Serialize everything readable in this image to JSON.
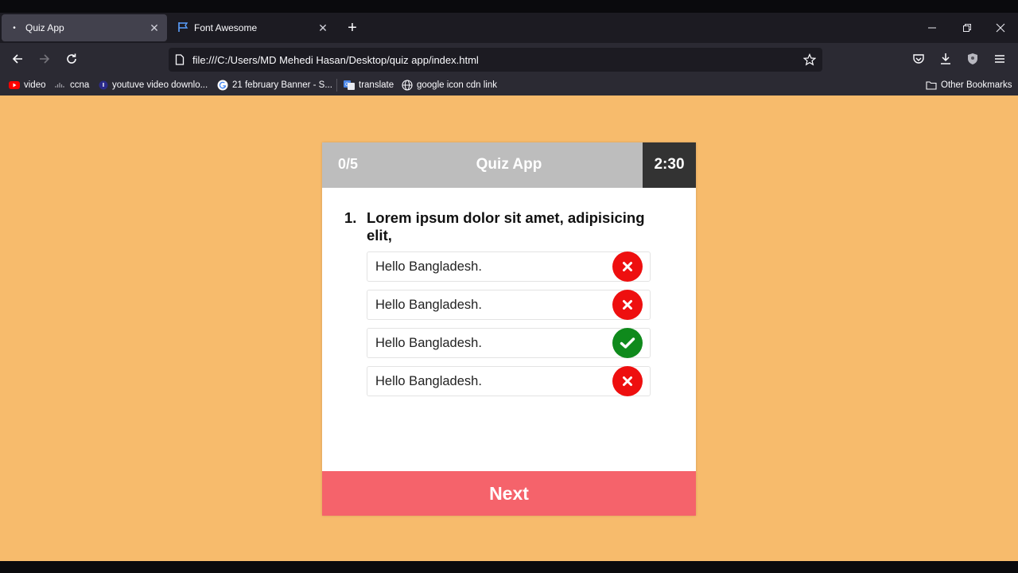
{
  "browser": {
    "tabs": [
      {
        "title": "Quiz App",
        "active": true
      },
      {
        "title": "Font Awesome",
        "active": false
      }
    ],
    "url": "file:///C:/Users/MD Mehedi Hasan/Desktop/quiz app/index.html",
    "bookmarks": [
      {
        "label": "video",
        "icon": "youtube-icon"
      },
      {
        "label": "ccna",
        "icon": "cisco-icon"
      },
      {
        "label": "youtuve video downlo...",
        "icon": "download-site-icon"
      },
      {
        "label": "21 february Banner - S...",
        "icon": "google-icon"
      },
      {
        "label": "translate",
        "icon": "translate-icon"
      },
      {
        "label": "google icon cdn link",
        "icon": "globe-icon"
      }
    ],
    "other_bookmarks": "Other Bookmarks"
  },
  "quiz": {
    "score": "0/5",
    "title": "Quiz App",
    "timer": "2:30",
    "question_number": "1.",
    "question_text": "Lorem ipsum dolor sit amet, adipisicing elit,",
    "options": [
      {
        "text": "Hello Bangladesh.",
        "status": "wrong",
        "icon": "times-icon"
      },
      {
        "text": "Hello Bangladesh.",
        "status": "wrong",
        "icon": "times-icon"
      },
      {
        "text": "Hello Bangladesh.",
        "status": "correct",
        "icon": "check-icon"
      },
      {
        "text": "Hello Bangladesh.",
        "status": "wrong",
        "icon": "times-icon"
      }
    ],
    "next_label": "Next"
  },
  "colors": {
    "page_background": "#f7bb6c",
    "header_background": "#bdbdbd",
    "timer_background": "#333333",
    "wrong": "#ee0f0f",
    "correct": "#0f8a1c",
    "next_button": "#f5636b"
  }
}
